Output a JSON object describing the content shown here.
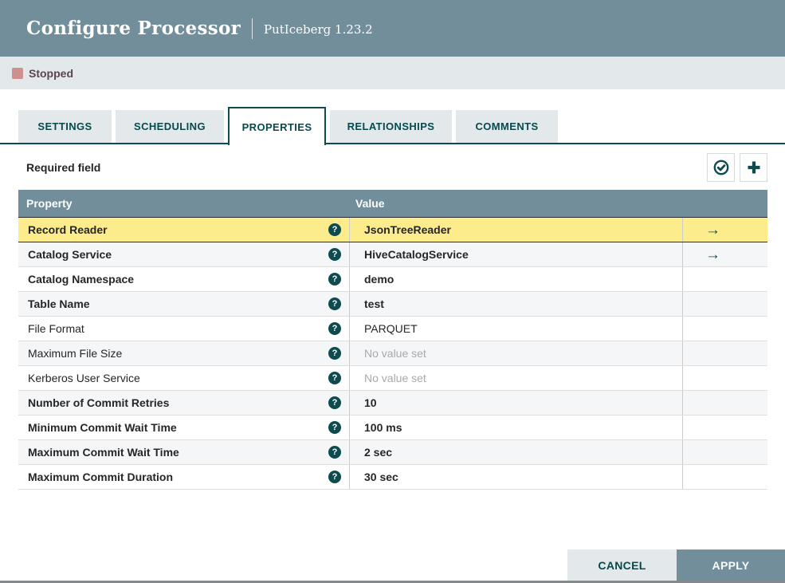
{
  "dialog": {
    "title": "Configure Processor",
    "subtitle": "PutIceberg 1.23.2"
  },
  "status": {
    "label": "Stopped",
    "color": "#D08F8F"
  },
  "tabs": [
    {
      "label": "SETTINGS",
      "active": false
    },
    {
      "label": "SCHEDULING",
      "active": false
    },
    {
      "label": "PROPERTIES",
      "active": true
    },
    {
      "label": "RELATIONSHIPS",
      "active": false
    },
    {
      "label": "COMMENTS",
      "active": false
    }
  ],
  "toolbar": {
    "required_field_label": "Required field",
    "icons": [
      {
        "name": "verify-properties-icon",
        "glyph": "check-circle"
      },
      {
        "name": "add-property-icon",
        "glyph": "plus"
      }
    ]
  },
  "table": {
    "columns": [
      "Property",
      "Value"
    ],
    "help_icon_glyph": "?",
    "goto_arrow_glyph": "→",
    "rows": [
      {
        "property": "Record Reader",
        "value": "JsonTreeReader",
        "required": true,
        "selected": true,
        "unset": false,
        "has_arrow": true
      },
      {
        "property": "Catalog Service",
        "value": "HiveCatalogService",
        "required": true,
        "selected": false,
        "unset": false,
        "has_arrow": true
      },
      {
        "property": "Catalog Namespace",
        "value": "demo",
        "required": true,
        "selected": false,
        "unset": false,
        "has_arrow": false
      },
      {
        "property": "Table Name",
        "value": "test",
        "required": true,
        "selected": false,
        "unset": false,
        "has_arrow": false
      },
      {
        "property": "File Format",
        "value": "PARQUET",
        "required": false,
        "selected": false,
        "unset": false,
        "has_arrow": false
      },
      {
        "property": "Maximum File Size",
        "value": "No value set",
        "required": false,
        "selected": false,
        "unset": true,
        "has_arrow": false
      },
      {
        "property": "Kerberos User Service",
        "value": "No value set",
        "required": false,
        "selected": false,
        "unset": true,
        "has_arrow": false
      },
      {
        "property": "Number of Commit Retries",
        "value": "10",
        "required": true,
        "selected": false,
        "unset": false,
        "has_arrow": false
      },
      {
        "property": "Minimum Commit Wait Time",
        "value": "100 ms",
        "required": true,
        "selected": false,
        "unset": false,
        "has_arrow": false
      },
      {
        "property": "Maximum Commit Wait Time",
        "value": "2 sec",
        "required": true,
        "selected": false,
        "unset": false,
        "has_arrow": false
      },
      {
        "property": "Maximum Commit Duration",
        "value": "30 sec",
        "required": true,
        "selected": false,
        "unset": false,
        "has_arrow": false
      }
    ]
  },
  "footer": {
    "cancel_label": "CANCEL",
    "apply_label": "APPLY"
  },
  "colors": {
    "header_bg": "#728E9B",
    "status_bg": "#E3E8EB",
    "accent_teal": "#0D4B4E",
    "selected_row_bg": "#FCEC8C",
    "alt_row_bg": "#F4F6F7",
    "unset_text": "#A9A9A9"
  }
}
